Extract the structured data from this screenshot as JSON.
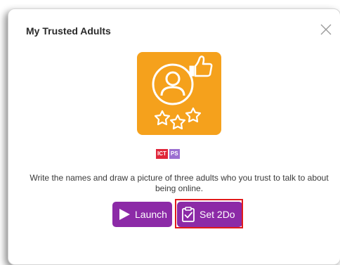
{
  "dialog": {
    "title": "My Trusted Adults",
    "close_icon": "close-icon",
    "app_icon": "trusted-adult-thumbs-up-stars-icon",
    "app_icon_color": "#f5a11c",
    "badges": [
      {
        "label": "ICT",
        "color": "#e0263a"
      },
      {
        "label": "PS",
        "color": "#9b6fd1"
      }
    ],
    "description": "Write the names and draw a picture of three adults who you trust to talk to about being online.",
    "buttons": {
      "launch_label": "Launch",
      "launch_icon": "play-icon",
      "set2do_label": "Set 2Do",
      "set2do_icon": "clipboard-check-icon",
      "button_color": "#8c2aa7"
    },
    "highlight_color": "#e11a1a"
  }
}
